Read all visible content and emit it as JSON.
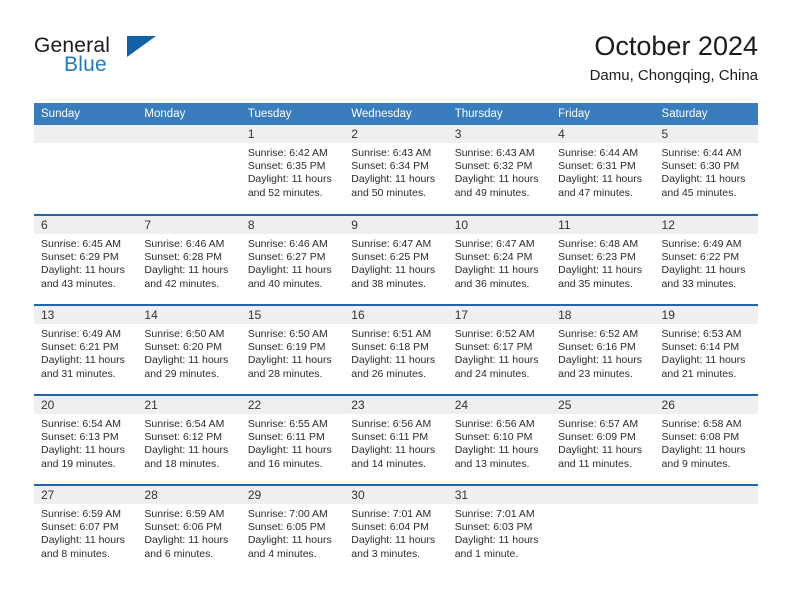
{
  "brand": {
    "name_top": "General",
    "name_bottom": "Blue",
    "accent_color": "#1f7ac0",
    "triangle_color": "#1361a8",
    "logo_icon": "triangle-icon"
  },
  "header": {
    "title": "October 2024",
    "subtitle": "Damu, Chongqing, China"
  },
  "theme": {
    "header_blue": "#3a7dbf",
    "row_line_blue": "#2165ab",
    "daynum_band": "#efefef"
  },
  "calendar": {
    "weekday_headers": [
      "Sunday",
      "Monday",
      "Tuesday",
      "Wednesday",
      "Thursday",
      "Friday",
      "Saturday"
    ],
    "weeks": [
      [
        {
          "day": "",
          "sunrise": "",
          "sunset": "",
          "daylight1": "",
          "daylight2": ""
        },
        {
          "day": "",
          "sunrise": "",
          "sunset": "",
          "daylight1": "",
          "daylight2": ""
        },
        {
          "day": "1",
          "sunrise": "Sunrise: 6:42 AM",
          "sunset": "Sunset: 6:35 PM",
          "daylight1": "Daylight: 11 hours",
          "daylight2": "and 52 minutes."
        },
        {
          "day": "2",
          "sunrise": "Sunrise: 6:43 AM",
          "sunset": "Sunset: 6:34 PM",
          "daylight1": "Daylight: 11 hours",
          "daylight2": "and 50 minutes."
        },
        {
          "day": "3",
          "sunrise": "Sunrise: 6:43 AM",
          "sunset": "Sunset: 6:32 PM",
          "daylight1": "Daylight: 11 hours",
          "daylight2": "and 49 minutes."
        },
        {
          "day": "4",
          "sunrise": "Sunrise: 6:44 AM",
          "sunset": "Sunset: 6:31 PM",
          "daylight1": "Daylight: 11 hours",
          "daylight2": "and 47 minutes."
        },
        {
          "day": "5",
          "sunrise": "Sunrise: 6:44 AM",
          "sunset": "Sunset: 6:30 PM",
          "daylight1": "Daylight: 11 hours",
          "daylight2": "and 45 minutes."
        }
      ],
      [
        {
          "day": "6",
          "sunrise": "Sunrise: 6:45 AM",
          "sunset": "Sunset: 6:29 PM",
          "daylight1": "Daylight: 11 hours",
          "daylight2": "and 43 minutes."
        },
        {
          "day": "7",
          "sunrise": "Sunrise: 6:46 AM",
          "sunset": "Sunset: 6:28 PM",
          "daylight1": "Daylight: 11 hours",
          "daylight2": "and 42 minutes."
        },
        {
          "day": "8",
          "sunrise": "Sunrise: 6:46 AM",
          "sunset": "Sunset: 6:27 PM",
          "daylight1": "Daylight: 11 hours",
          "daylight2": "and 40 minutes."
        },
        {
          "day": "9",
          "sunrise": "Sunrise: 6:47 AM",
          "sunset": "Sunset: 6:25 PM",
          "daylight1": "Daylight: 11 hours",
          "daylight2": "and 38 minutes."
        },
        {
          "day": "10",
          "sunrise": "Sunrise: 6:47 AM",
          "sunset": "Sunset: 6:24 PM",
          "daylight1": "Daylight: 11 hours",
          "daylight2": "and 36 minutes."
        },
        {
          "day": "11",
          "sunrise": "Sunrise: 6:48 AM",
          "sunset": "Sunset: 6:23 PM",
          "daylight1": "Daylight: 11 hours",
          "daylight2": "and 35 minutes."
        },
        {
          "day": "12",
          "sunrise": "Sunrise: 6:49 AM",
          "sunset": "Sunset: 6:22 PM",
          "daylight1": "Daylight: 11 hours",
          "daylight2": "and 33 minutes."
        }
      ],
      [
        {
          "day": "13",
          "sunrise": "Sunrise: 6:49 AM",
          "sunset": "Sunset: 6:21 PM",
          "daylight1": "Daylight: 11 hours",
          "daylight2": "and 31 minutes."
        },
        {
          "day": "14",
          "sunrise": "Sunrise: 6:50 AM",
          "sunset": "Sunset: 6:20 PM",
          "daylight1": "Daylight: 11 hours",
          "daylight2": "and 29 minutes."
        },
        {
          "day": "15",
          "sunrise": "Sunrise: 6:50 AM",
          "sunset": "Sunset: 6:19 PM",
          "daylight1": "Daylight: 11 hours",
          "daylight2": "and 28 minutes."
        },
        {
          "day": "16",
          "sunrise": "Sunrise: 6:51 AM",
          "sunset": "Sunset: 6:18 PM",
          "daylight1": "Daylight: 11 hours",
          "daylight2": "and 26 minutes."
        },
        {
          "day": "17",
          "sunrise": "Sunrise: 6:52 AM",
          "sunset": "Sunset: 6:17 PM",
          "daylight1": "Daylight: 11 hours",
          "daylight2": "and 24 minutes."
        },
        {
          "day": "18",
          "sunrise": "Sunrise: 6:52 AM",
          "sunset": "Sunset: 6:16 PM",
          "daylight1": "Daylight: 11 hours",
          "daylight2": "and 23 minutes."
        },
        {
          "day": "19",
          "sunrise": "Sunrise: 6:53 AM",
          "sunset": "Sunset: 6:14 PM",
          "daylight1": "Daylight: 11 hours",
          "daylight2": "and 21 minutes."
        }
      ],
      [
        {
          "day": "20",
          "sunrise": "Sunrise: 6:54 AM",
          "sunset": "Sunset: 6:13 PM",
          "daylight1": "Daylight: 11 hours",
          "daylight2": "and 19 minutes."
        },
        {
          "day": "21",
          "sunrise": "Sunrise: 6:54 AM",
          "sunset": "Sunset: 6:12 PM",
          "daylight1": "Daylight: 11 hours",
          "daylight2": "and 18 minutes."
        },
        {
          "day": "22",
          "sunrise": "Sunrise: 6:55 AM",
          "sunset": "Sunset: 6:11 PM",
          "daylight1": "Daylight: 11 hours",
          "daylight2": "and 16 minutes."
        },
        {
          "day": "23",
          "sunrise": "Sunrise: 6:56 AM",
          "sunset": "Sunset: 6:11 PM",
          "daylight1": "Daylight: 11 hours",
          "daylight2": "and 14 minutes."
        },
        {
          "day": "24",
          "sunrise": "Sunrise: 6:56 AM",
          "sunset": "Sunset: 6:10 PM",
          "daylight1": "Daylight: 11 hours",
          "daylight2": "and 13 minutes."
        },
        {
          "day": "25",
          "sunrise": "Sunrise: 6:57 AM",
          "sunset": "Sunset: 6:09 PM",
          "daylight1": "Daylight: 11 hours",
          "daylight2": "and 11 minutes."
        },
        {
          "day": "26",
          "sunrise": "Sunrise: 6:58 AM",
          "sunset": "Sunset: 6:08 PM",
          "daylight1": "Daylight: 11 hours",
          "daylight2": "and 9 minutes."
        }
      ],
      [
        {
          "day": "27",
          "sunrise": "Sunrise: 6:59 AM",
          "sunset": "Sunset: 6:07 PM",
          "daylight1": "Daylight: 11 hours",
          "daylight2": "and 8 minutes."
        },
        {
          "day": "28",
          "sunrise": "Sunrise: 6:59 AM",
          "sunset": "Sunset: 6:06 PM",
          "daylight1": "Daylight: 11 hours",
          "daylight2": "and 6 minutes."
        },
        {
          "day": "29",
          "sunrise": "Sunrise: 7:00 AM",
          "sunset": "Sunset: 6:05 PM",
          "daylight1": "Daylight: 11 hours",
          "daylight2": "and 4 minutes."
        },
        {
          "day": "30",
          "sunrise": "Sunrise: 7:01 AM",
          "sunset": "Sunset: 6:04 PM",
          "daylight1": "Daylight: 11 hours",
          "daylight2": "and 3 minutes."
        },
        {
          "day": "31",
          "sunrise": "Sunrise: 7:01 AM",
          "sunset": "Sunset: 6:03 PM",
          "daylight1": "Daylight: 11 hours",
          "daylight2": "and 1 minute."
        },
        {
          "day": "",
          "sunrise": "",
          "sunset": "",
          "daylight1": "",
          "daylight2": ""
        },
        {
          "day": "",
          "sunrise": "",
          "sunset": "",
          "daylight1": "",
          "daylight2": ""
        }
      ]
    ]
  }
}
